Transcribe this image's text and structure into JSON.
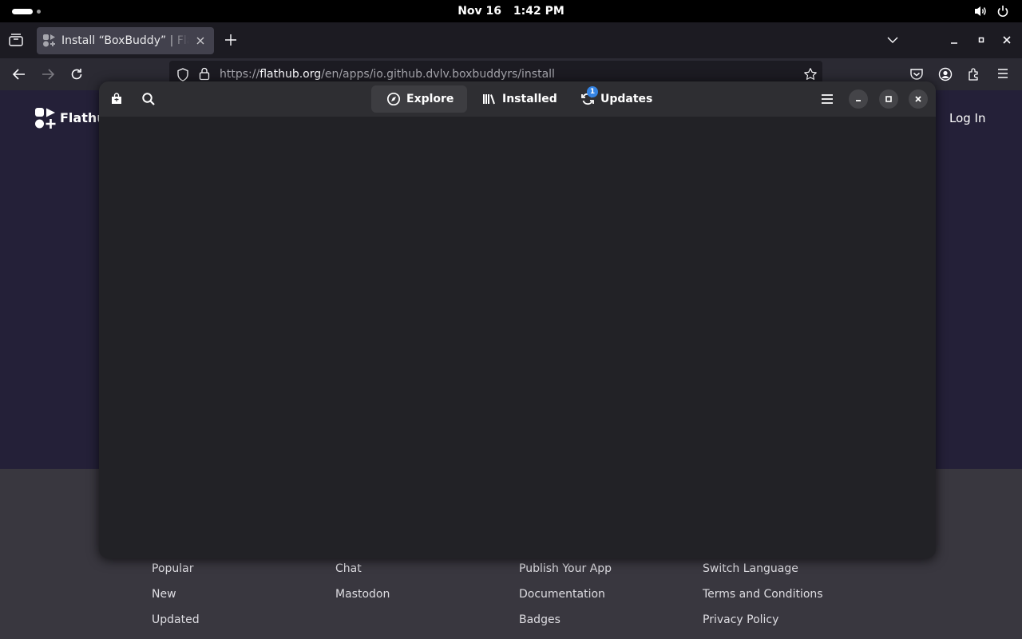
{
  "topbar": {
    "date": "Nov 16",
    "time": "1:42 PM"
  },
  "browser": {
    "tab": {
      "title": "Install “BoxBuddy” | Flathub"
    },
    "url": {
      "scheme": "https://",
      "host": "flathub.org",
      "path": "/en/apps/io.github.dvlv.boxbuddyrs/install"
    }
  },
  "page": {
    "logo_text": "Flathub",
    "login": "Log In",
    "footer": {
      "col1": [
        "Popular",
        "New",
        "Updated"
      ],
      "col2": [
        "Chat",
        "Mastodon"
      ],
      "col3": [
        "Publish Your App",
        "Documentation",
        "Badges"
      ],
      "col4": [
        "Switch Language",
        "Terms and Conditions",
        "Privacy Policy"
      ]
    }
  },
  "software": {
    "tabs": {
      "explore": "Explore",
      "installed": "Installed",
      "updates": "Updates"
    },
    "updates_count": "1",
    "accent": "#3584e4"
  }
}
